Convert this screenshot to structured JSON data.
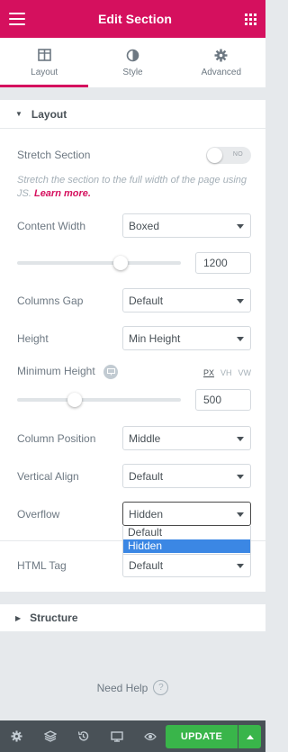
{
  "header": {
    "title": "Edit Section",
    "menu_icon": "hamburger-icon",
    "apps_icon": "grid-icon",
    "accent_color": "#d5105e"
  },
  "tabs": [
    {
      "label": "Layout",
      "icon": "columns-icon",
      "active": true
    },
    {
      "label": "Style",
      "icon": "half-circle-icon",
      "active": false
    },
    {
      "label": "Advanced",
      "icon": "gear-icon",
      "active": false
    }
  ],
  "layout_section": {
    "title": "Layout",
    "stretch": {
      "label": "Stretch Section",
      "toggle_text": "NO",
      "description": "Stretch the section to the full width of the page using JS.",
      "learn_more": "Learn more."
    },
    "content_width": {
      "label": "Content Width",
      "value": "Boxed"
    },
    "width_slider": {
      "value": "1200",
      "fraction": 0.63
    },
    "columns_gap": {
      "label": "Columns Gap",
      "value": "Default"
    },
    "height": {
      "label": "Height",
      "value": "Min Height"
    },
    "min_height": {
      "label": "Minimum Height",
      "units": [
        "PX",
        "VH",
        "VW"
      ],
      "active_unit": "PX",
      "value": "500",
      "fraction": 0.35
    },
    "column_position": {
      "label": "Column Position",
      "value": "Middle"
    },
    "vertical_align": {
      "label": "Vertical Align",
      "value": "Default"
    },
    "overflow": {
      "label": "Overflow",
      "value": "Hidden",
      "options": [
        "Default",
        "Hidden"
      ],
      "selected_index": 1
    },
    "html_tag": {
      "label": "HTML Tag",
      "value": "Default"
    }
  },
  "structure_section": {
    "title": "Structure"
  },
  "help": {
    "label": "Need Help"
  },
  "footer": {
    "icons": [
      "settings-icon",
      "layers-icon",
      "history-icon",
      "responsive-icon",
      "preview-icon"
    ],
    "update_label": "UPDATE",
    "update_color": "#39b54a"
  }
}
